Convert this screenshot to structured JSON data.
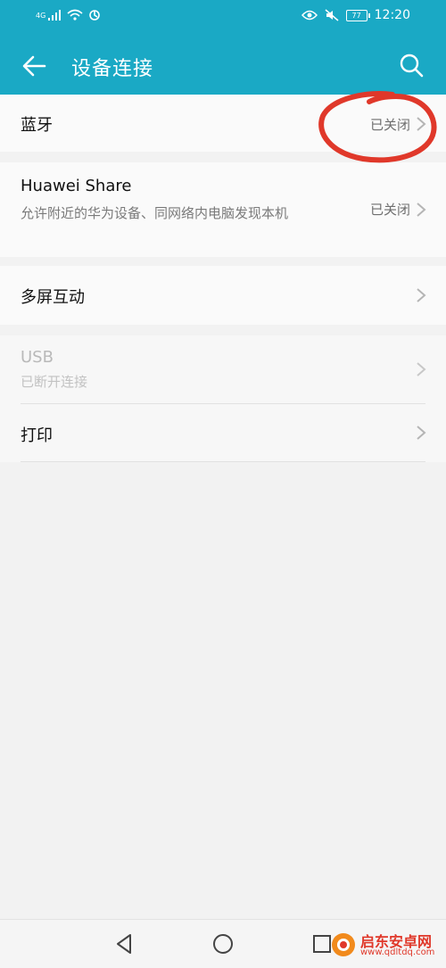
{
  "status_bar": {
    "network": "4G",
    "time": "12:20",
    "battery": "77"
  },
  "header": {
    "title": "设备连接"
  },
  "items": {
    "bluetooth": {
      "label": "蓝牙",
      "value": "已关闭"
    },
    "huawei_share": {
      "label": "Huawei Share",
      "description": "允许附近的华为设备、同网络内电脑发现本机",
      "value": "已关闭"
    },
    "multiscreen": {
      "label": "多屏互动"
    },
    "usb": {
      "label": "USB",
      "sublabel": "已断开连接"
    },
    "print": {
      "label": "打印"
    }
  },
  "watermark": {
    "text": "启东安卓网",
    "url": "www.qdltdq.com"
  },
  "colors": {
    "accent": "#1aa9c5",
    "annotation": "#e0382a"
  }
}
